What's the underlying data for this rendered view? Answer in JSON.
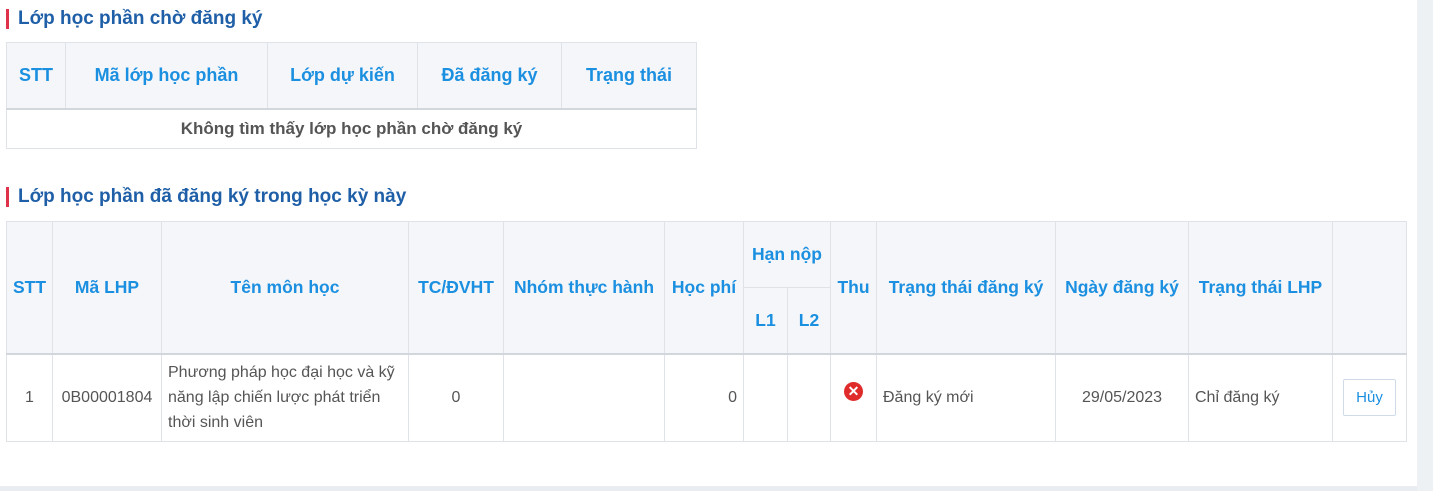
{
  "pending": {
    "title": "Lớp học phần chờ đăng ký",
    "headers": [
      "STT",
      "Mã lớp học phần",
      "Lớp dự kiến",
      "Đã đăng ký",
      "Trạng thái"
    ],
    "empty_message": "Không tìm thấy lớp học phần chờ đăng ký"
  },
  "registered": {
    "title": "Lớp học phần đã đăng ký trong học kỳ này",
    "headers": {
      "stt": "STT",
      "ma_lhp": "Mã LHP",
      "ten_mon": "Tên môn học",
      "tc": "TC/ĐVHT",
      "nhom": "Nhóm thực hành",
      "hoc_phi": "Học phí",
      "han_nop": "Hạn nộp",
      "l1": "L1",
      "l2": "L2",
      "thu": "Thu",
      "trang_thai_dk": "Trạng thái đăng ký",
      "ngay_dk": "Ngày đăng ký",
      "trang_thai_lhp": "Trạng thái LHP"
    },
    "rows": [
      {
        "stt": "1",
        "ma_lhp": "0B00001804",
        "ten_mon": "Phương pháp học đại học và kỹ năng lập chiến lược phát triển thời sinh viên",
        "tc": "0",
        "nhom": "",
        "hoc_phi": "0",
        "l1": "",
        "l2": "",
        "thu_icon": "x-circle-icon",
        "trang_thai_dk": "Đăng ký mới",
        "ngay_dk": "29/05/2023",
        "trang_thai_lhp": "Chỉ đăng ký",
        "action": "Hủy"
      }
    ]
  },
  "colors": {
    "accent": "#1b8fe0",
    "title": "#1f5fa7",
    "marker": "#e0314b",
    "error": "#e02b2b"
  }
}
